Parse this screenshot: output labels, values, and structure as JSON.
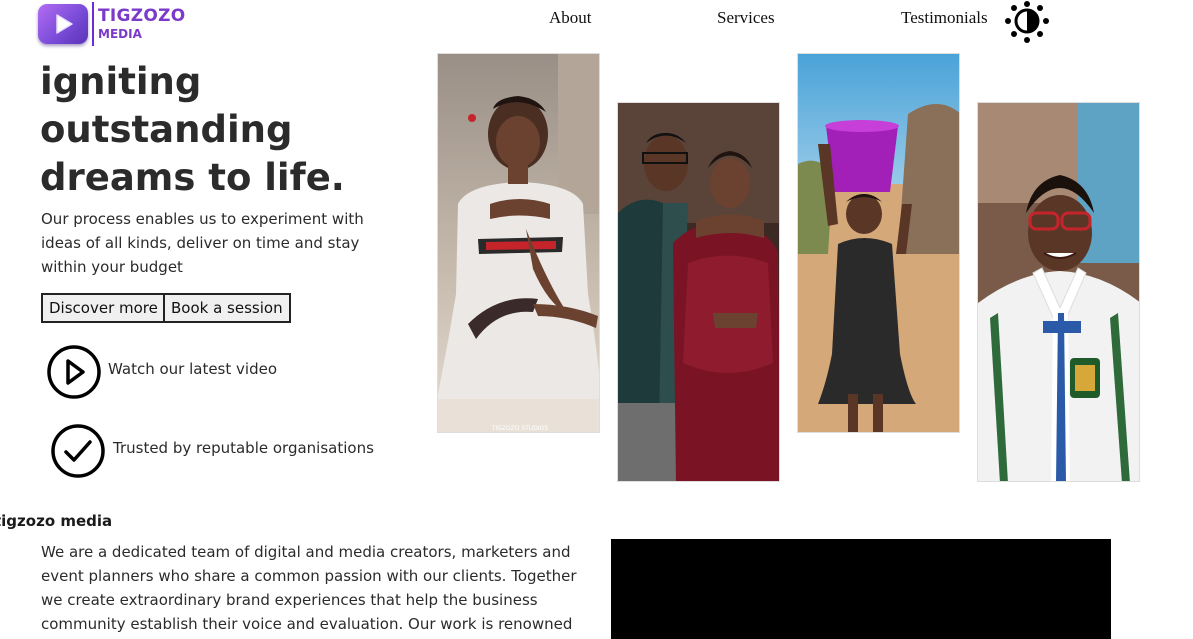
{
  "brand": {
    "name": "TIGZOZO",
    "sub": "MEDIA",
    "icon": "play-logo-icon",
    "gradient": [
      "#b46cf2",
      "#5a33b8"
    ],
    "text_color": "#7b3ac9"
  },
  "nav": {
    "items": [
      {
        "label": "About"
      },
      {
        "label": "Services"
      },
      {
        "label": "Testimonials"
      }
    ],
    "theme_toggle_icon": "contrast-sun-icon"
  },
  "hero": {
    "heading_lines": [
      "igniting",
      "outstanding",
      "dreams to life."
    ],
    "description": "Our process enables us to experiment with ideas of all kinds, deliver on time and stay within your budget",
    "buttons": {
      "discover": "Discover more",
      "book": "Book a session"
    },
    "features": [
      {
        "icon": "play-circle-icon",
        "label": "Watch our latest video"
      },
      {
        "icon": "check-circle-icon",
        "label": "Trusted by reputable organisations"
      }
    ]
  },
  "gallery": {
    "photos": [
      {
        "name": "bride-photo",
        "watermark": "TIGZOZO STUDIOS"
      },
      {
        "name": "couple-photo"
      },
      {
        "name": "girl-with-bucket-photo"
      },
      {
        "name": "student-photo"
      }
    ]
  },
  "about": {
    "title": "tigzozo media",
    "body": "We are a dedicated team of digital and media creators, marketers and event planners who share a common passion with our clients. Together we create extraordinary brand experiences that help the business community establish their voice and evaluation. Our work is renowned for its highly crafted design,"
  }
}
